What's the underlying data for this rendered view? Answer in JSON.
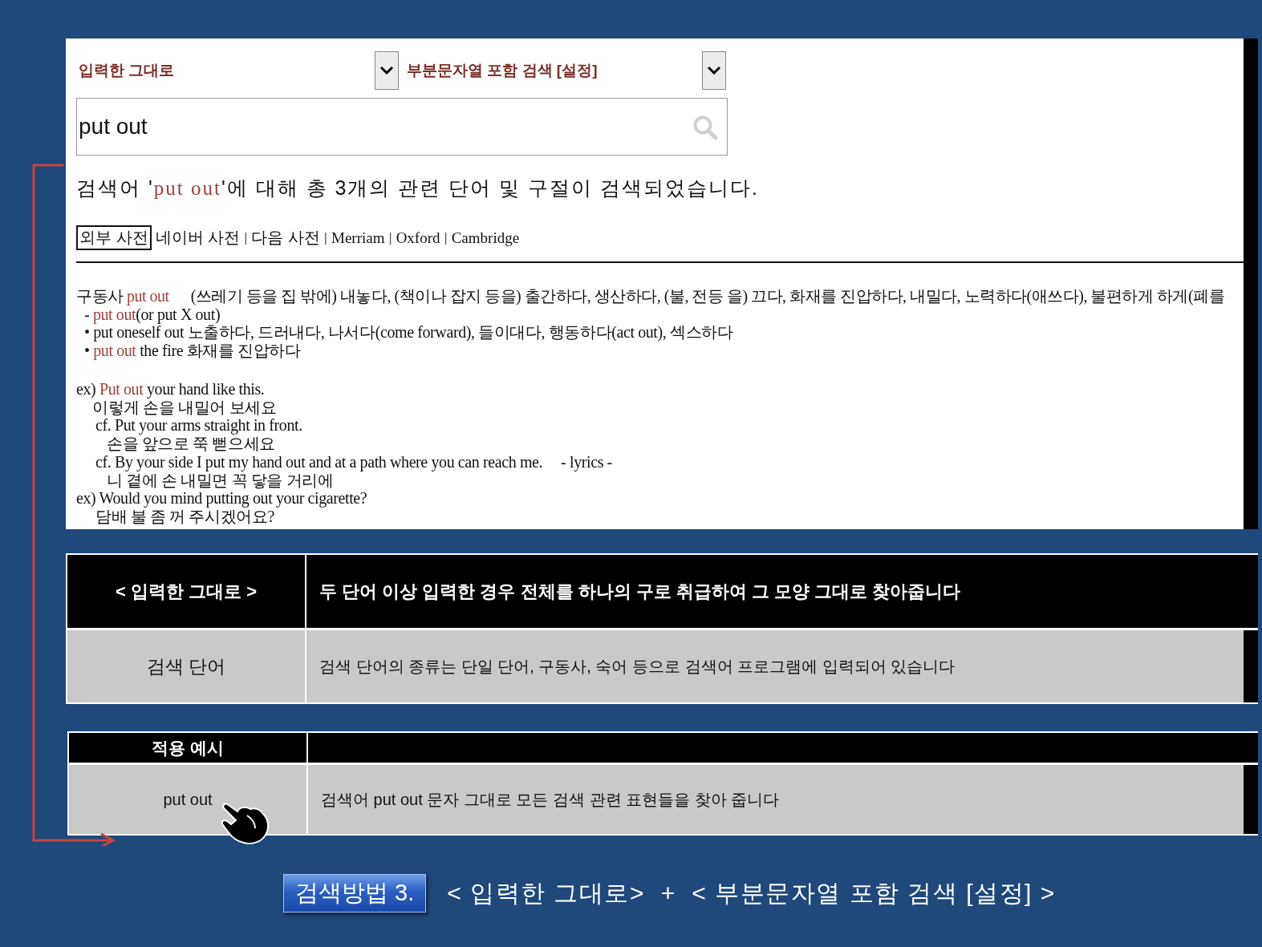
{
  "search_options": [
    {
      "label": "입력한 그대로"
    },
    {
      "label": "부분문자열 포함 검색 [설정]"
    }
  ],
  "search": {
    "value": "put out"
  },
  "result_summary": {
    "before": "검색어 '",
    "term": "put out",
    "after": "'에 대해 총 3개의 관련 단어 및 구절이 검색되었습니다."
  },
  "dictionary_links": [
    {
      "label": "외부 사전",
      "kind": "boxed"
    },
    {
      "label": "네이버 사전",
      "kind": "link"
    },
    {
      "label": "|",
      "kind": "separator"
    },
    {
      "label": "다음 사전",
      "kind": "link"
    },
    {
      "label": "|",
      "kind": "separator"
    },
    {
      "label": "Merriam",
      "kind": "link"
    },
    {
      "label": "|",
      "kind": "separator"
    },
    {
      "label": "Oxford",
      "kind": "link"
    },
    {
      "label": "|",
      "kind": "separator"
    },
    {
      "label": "Cambridge",
      "kind": "link"
    }
  ],
  "definition_lines": [
    {
      "kind": "head",
      "parts": [
        {
          "text": "구동사 ",
          "highlight": false
        },
        {
          "text": "put out",
          "highlight": true
        },
        {
          "text": "      (쓰레기 등을 집 밖에) 내놓다, (책이나 잡지 등을) 출간하다, 생산하다, (불, 전등 을) 끄다, 화재를 진압하다, 내밀다, 노력하다(애쓰다), 불편하게 하게(폐를",
          "highlight": false
        }
      ]
    },
    {
      "kind": "sub",
      "parts": [
        {
          "text": "- ",
          "highlight": false
        },
        {
          "text": "put out",
          "highlight": true
        },
        {
          "text": "(or put X out)",
          "highlight": false
        }
      ]
    },
    {
      "kind": "sub",
      "parts": [
        {
          "text": "• put oneself out 노출하다, 드러내다, 나서다(come forward), 들이대다, 행동하다(act out), 섹스하다",
          "highlight": false
        }
      ]
    },
    {
      "kind": "sub",
      "parts": [
        {
          "text": "• ",
          "highlight": false
        },
        {
          "text": "put out",
          "highlight": true
        },
        {
          "text": " the fire 화재를 진압하다",
          "highlight": false
        }
      ]
    },
    {
      "kind": "example",
      "parts": [
        {
          "text": "ex) ",
          "highlight": false
        },
        {
          "text": "Put out",
          "highlight": true
        },
        {
          "text": " your hand like this.",
          "highlight": false
        }
      ]
    },
    {
      "kind": "translation",
      "parts": [
        {
          "text": "이렇게 손을 내밀어 보세요",
          "highlight": false
        }
      ]
    },
    {
      "kind": "cf",
      "parts": [
        {
          "text": "cf. Put your arms straight in front.",
          "highlight": false
        }
      ]
    },
    {
      "kind": "cf_translation",
      "parts": [
        {
          "text": "손을 앞으로 쭉 뻗으세요",
          "highlight": false
        }
      ]
    },
    {
      "kind": "cf",
      "parts": [
        {
          "text": "cf. By your side I put my hand out and at a path where you can reach me.     - lyrics -",
          "highlight": false
        }
      ]
    },
    {
      "kind": "cf_translation",
      "parts": [
        {
          "text": "니 곁에 손 내밀면 꼭 닿을 거리에",
          "highlight": false
        }
      ]
    },
    {
      "kind": "example",
      "parts": [
        {
          "text": "ex) Would you mind putting out your cigarette?",
          "highlight": false
        }
      ]
    },
    {
      "kind": "translation2",
      "parts": [
        {
          "text": "담배 불 좀 꺼 주시겠어요?",
          "highlight": false
        }
      ]
    }
  ],
  "mode_table": {
    "header": [
      "< 입력한 그대로 >",
      "두 단어 이상 입력한 경우 전체를 하나의 구로 취급하여 그 모양 그대로 찾아줍니다"
    ],
    "row": [
      "검색 단어",
      "검색 단어의 종류는 단일 단어, 구동사, 숙어 등으로 검색어 프로그램에 입력되어 있습니다"
    ]
  },
  "example_table": {
    "header": [
      "적용 예시"
    ],
    "row": [
      "put out",
      "검색어 put out 문자 그대로 모든 검색 관련 표현들을 찾아 줍니다"
    ]
  },
  "footer": {
    "badge": "검색방법 3.",
    "title": "< 입력한 그대로>  +  < 부분문자열 포함 검색 [설정] >"
  }
}
